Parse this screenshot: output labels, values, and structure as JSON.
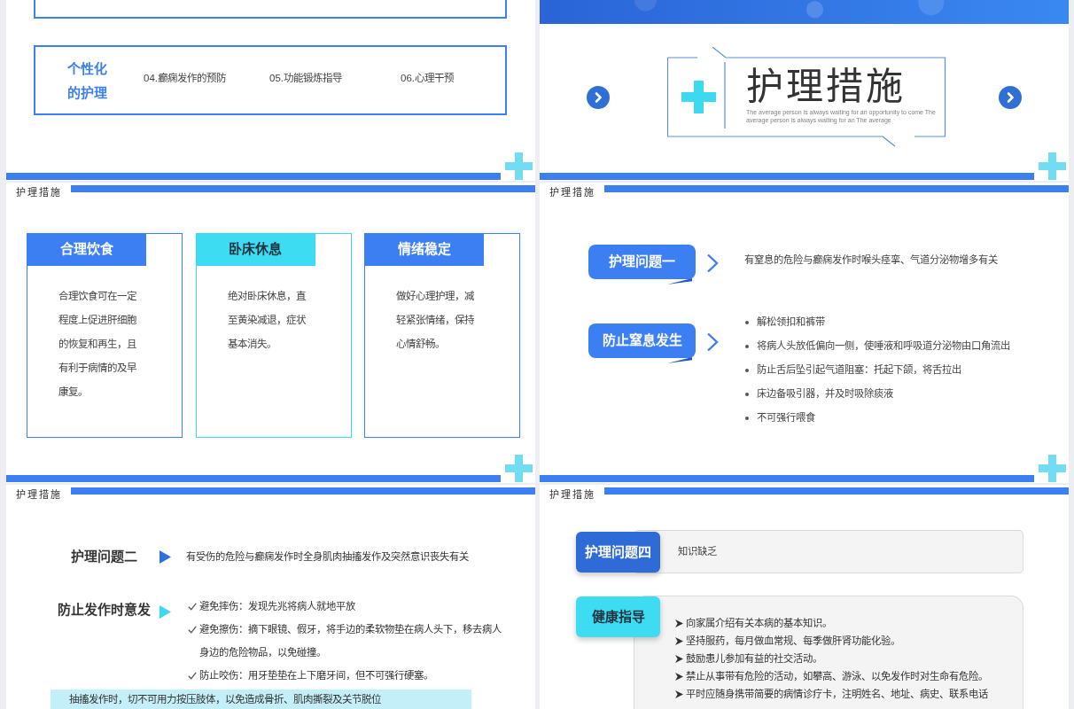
{
  "slides": [
    {
      "kind": "overview",
      "group_box": {
        "label": "个性化的护理",
        "items": [
          "04.癫痫发作的预防",
          "05.功能锻炼指导",
          "06.心理干预"
        ]
      }
    },
    {
      "kind": "section_title",
      "title": "护理措施",
      "subtitle": "The average person is always waiting for an opportunity to come The average person is always waiting for an The average"
    },
    {
      "kind": "cards",
      "header": "护理措施",
      "cards": [
        {
          "title": "合理饮食",
          "body": "合理饮食可在一定程度上促进肝细胞的恢复和再生，且有利于病情的及早康复。",
          "color": "#3b7ff2"
        },
        {
          "title": "卧床休息",
          "body": "绝对卧床休息，直至黄染减退，症状基本消失。",
          "color": "#3ddcf2"
        },
        {
          "title": "情绪稳定",
          "body": "做好心理护理，减轻紧张情绪，保持心情舒畅。",
          "color": "#3b7ff2"
        }
      ]
    },
    {
      "kind": "problems",
      "header": "护理措施",
      "rows": [
        {
          "kind": "text",
          "label": "护理问题一",
          "text": "有窒息的危险与癫痫发作时喉头痉挛、气道分泌物增多有关"
        },
        {
          "kind": "list",
          "label": "防止窒息发生",
          "items": [
            "解松领扣和裤带",
            "将病人头放低偏向一侧，使唾液和呼吸道分泌物由口角流出",
            "防止舌后坠引起气道阻塞：托起下颌，将舌拉出",
            "床边备吸引器，并及时吸除痰液",
            "不可强行喂食"
          ]
        }
      ]
    },
    {
      "kind": "checklist",
      "header": "护理措施",
      "rows": [
        {
          "kind": "text",
          "label": "护理问题二",
          "color": "#2f6fe0",
          "text": "有受伤的危险与癫痫发作时全身肌肉抽搐发作及突然意识丧失有关"
        },
        {
          "kind": "list",
          "label": "防止发作时意发",
          "color": "#3fd6f0",
          "items": [
            "避免摔伤：发现先兆将病人就地平放",
            "避免擦伤：摘下眼镜、假牙，将手边的柔软物垫在病人头下，移去病人身边的危险物品，以免碰撞。",
            "防止咬伤：用牙垫垫在上下磨牙间，但不可强行硬塞。"
          ]
        }
      ],
      "note": "抽搐发作时，切不可用力按压肢体，以免造成骨折、肌肉撕裂及关节脱位"
    },
    {
      "kind": "panels",
      "header": "护理措施",
      "rows": [
        {
          "kind": "text",
          "label": "护理问题四",
          "color": "#2f6bd6",
          "text": "知识缺乏"
        },
        {
          "kind": "list",
          "label": "健康指导",
          "color": "#3ddcf2",
          "items": [
            "向家属介绍有关本病的基本知识。",
            "坚持服药，每月做血常规、每季做肝肾功能化验。",
            "鼓励患儿参加有益的社交活动。",
            "禁止从事带有危险的活动，如攀高、游泳、以免发作时对生命有危险。",
            "平时应随身携带简要的病情诊疗卡，注明姓名、地址、病史、联系电话"
          ]
        }
      ]
    }
  ]
}
